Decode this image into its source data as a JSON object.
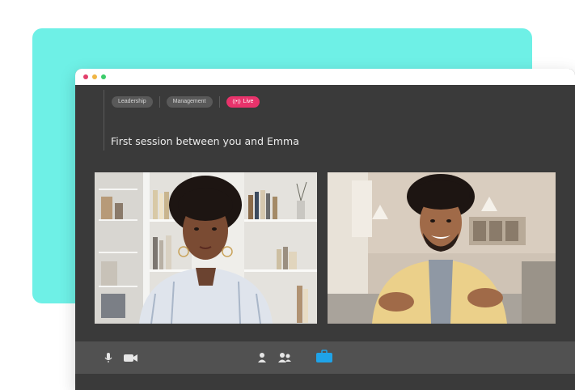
{
  "colors": {
    "teal": "#6ef0e6",
    "live": "#e8336b",
    "accent_blue": "#1fa3e8",
    "window_bg": "#3a3a3a",
    "footer_bg": "#515151"
  },
  "window_dots": [
    "#e23e6b",
    "#f0b545",
    "#3ccc6a"
  ],
  "tags": [
    {
      "label": "Leadership"
    },
    {
      "label": "Management"
    }
  ],
  "live_tag": {
    "label": "Live",
    "icon": "broadcast-icon"
  },
  "session": {
    "title": "First session between you and Emma"
  },
  "videos": [
    {
      "name": "participant-woman"
    },
    {
      "name": "participant-man"
    }
  ],
  "controls": [
    "microphone-icon",
    "camera-icon",
    "user-icon",
    "users-icon",
    "briefcase-icon"
  ]
}
